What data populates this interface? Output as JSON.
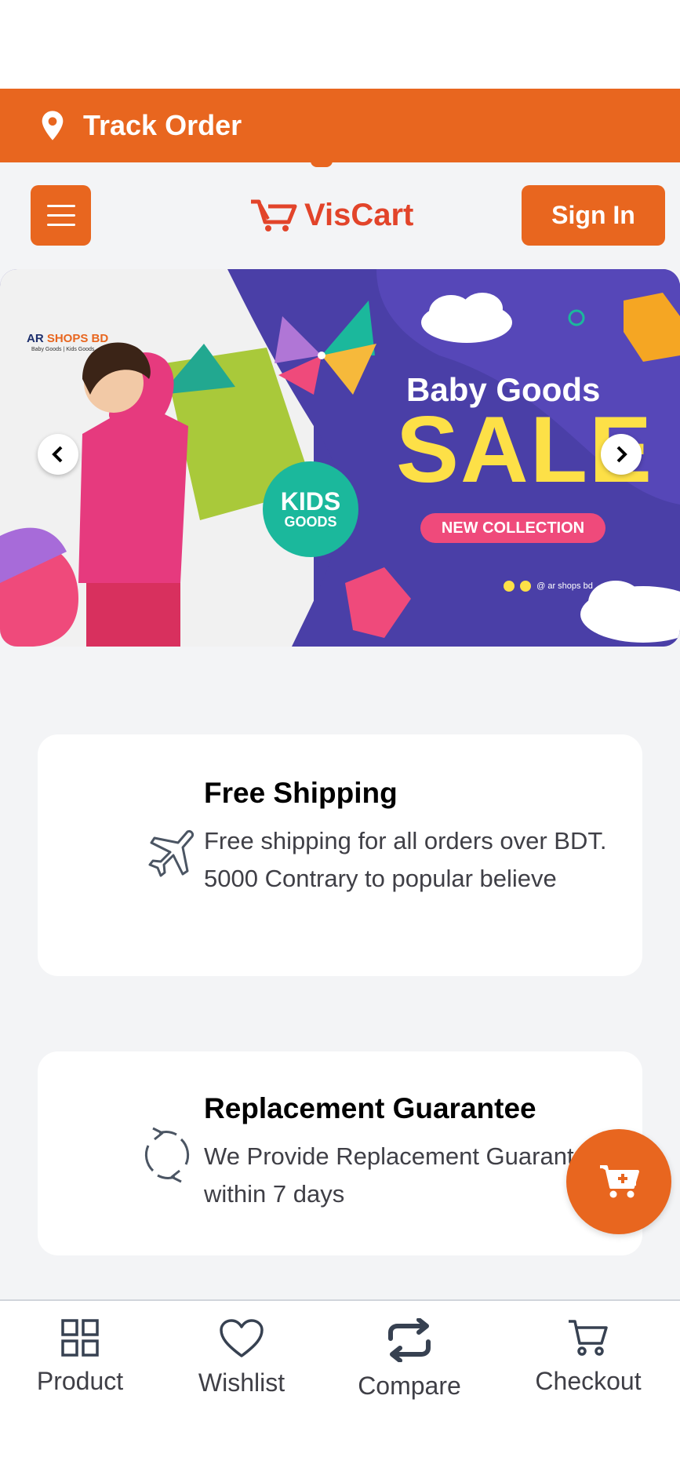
{
  "track_bar": {
    "label": "Track Order"
  },
  "header": {
    "logo_text": "VisCart",
    "signin_label": "Sign In"
  },
  "banner": {
    "brand_prefix": "AR ",
    "brand_suffix": "SHOPS BD",
    "brand_sub": "Baby Goods | Kids Goods",
    "title": "Baby Goods",
    "sale": "SALE",
    "badge_line1": "KIDS",
    "badge_line2": "GOODS",
    "collection": "NEW COLLECTION",
    "social_handle": "@ ar shops bd"
  },
  "features": [
    {
      "title": "Free Shipping",
      "description": "Free shipping for all orders over BDT. 5000 Contrary to popular believe"
    },
    {
      "title": "Replacement Guarantee",
      "description": "We Provide Replacement Guarantee within 7 days"
    }
  ],
  "bottom_nav": [
    {
      "label": "Product",
      "icon": "grid-icon"
    },
    {
      "label": "Wishlist",
      "icon": "heart-icon"
    },
    {
      "label": "Compare",
      "icon": "compare-icon"
    },
    {
      "label": "Checkout",
      "icon": "cart-icon"
    }
  ],
  "colors": {
    "accent": "#e8661f",
    "brand_red": "#e2442a",
    "banner_purple": "#4a3fa7",
    "sale_yellow": "#fde047"
  }
}
